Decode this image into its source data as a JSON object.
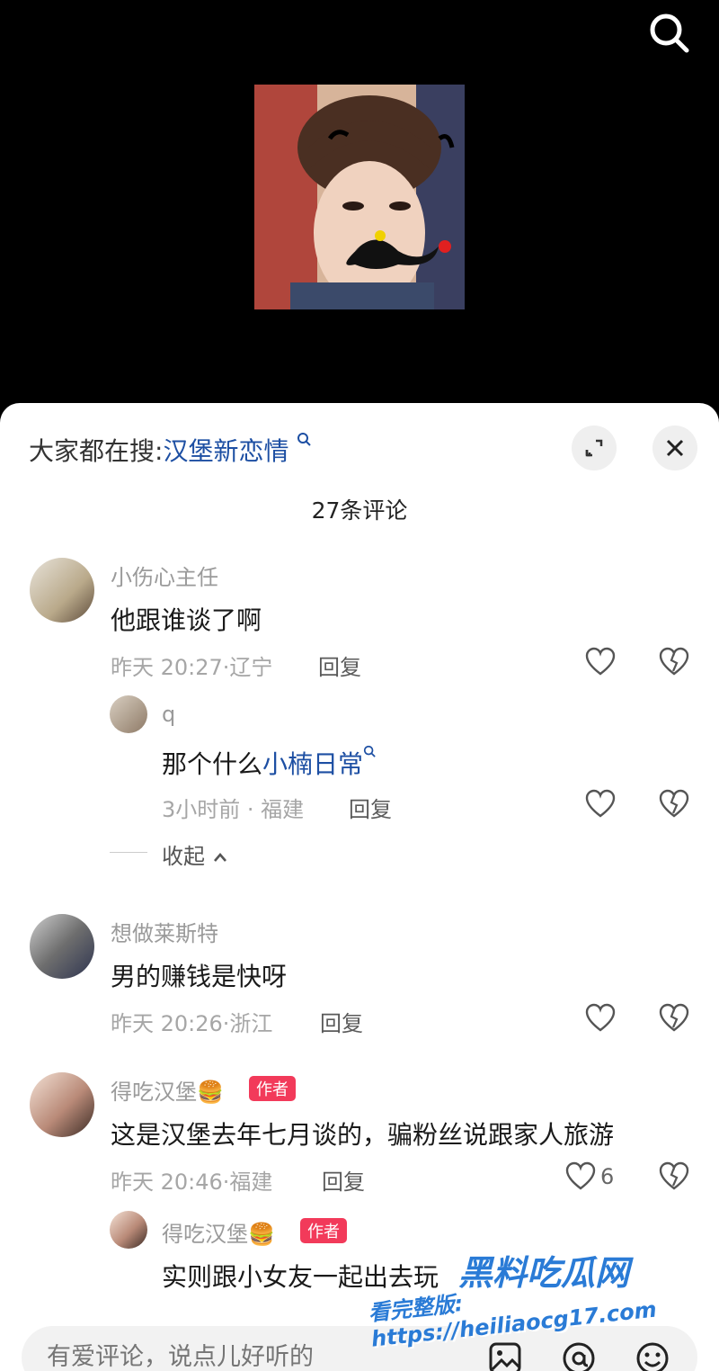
{
  "hot_search": {
    "prefix": "大家都在搜:",
    "keyword": "汉堡新恋情"
  },
  "comment_count": "27条评论",
  "reply_label": "回复",
  "comments": [
    {
      "user": "小伤心主任",
      "text": "他跟谁谈了啊",
      "time": "昨天 20:27·辽宁",
      "likes": ""
    },
    {
      "user": "q",
      "text_prefix": "那个什么",
      "link": "小楠日常",
      "time": "3小时前 · 福建",
      "likes": ""
    },
    {
      "collapse": "收起"
    },
    {
      "user": "想做莱斯特",
      "text": "男的赚钱是快呀",
      "time": "昨天 20:26·浙江",
      "likes": ""
    },
    {
      "user": "得吃汉堡🍔",
      "badge": "作者",
      "text": "这是汉堡去年七月谈的，骗粉丝说跟家人旅游",
      "time": "昨天 20:46·福建",
      "likes": "6"
    },
    {
      "user": "得吃汉堡🍔",
      "badge": "作者",
      "text": "实则跟小女友一起出去玩"
    }
  ],
  "input": {
    "placeholder": "有爱评论，说点儿好听的"
  },
  "watermark": {
    "title": "黑料吃瓜网",
    "line": "看完整版: https://heiliaocg17.com"
  },
  "icons": [
    "search-icon",
    "expand-icon",
    "close-icon",
    "heart-icon",
    "dislike-icon",
    "image-icon",
    "at-icon",
    "emoji-icon",
    "chevron-up-icon"
  ]
}
